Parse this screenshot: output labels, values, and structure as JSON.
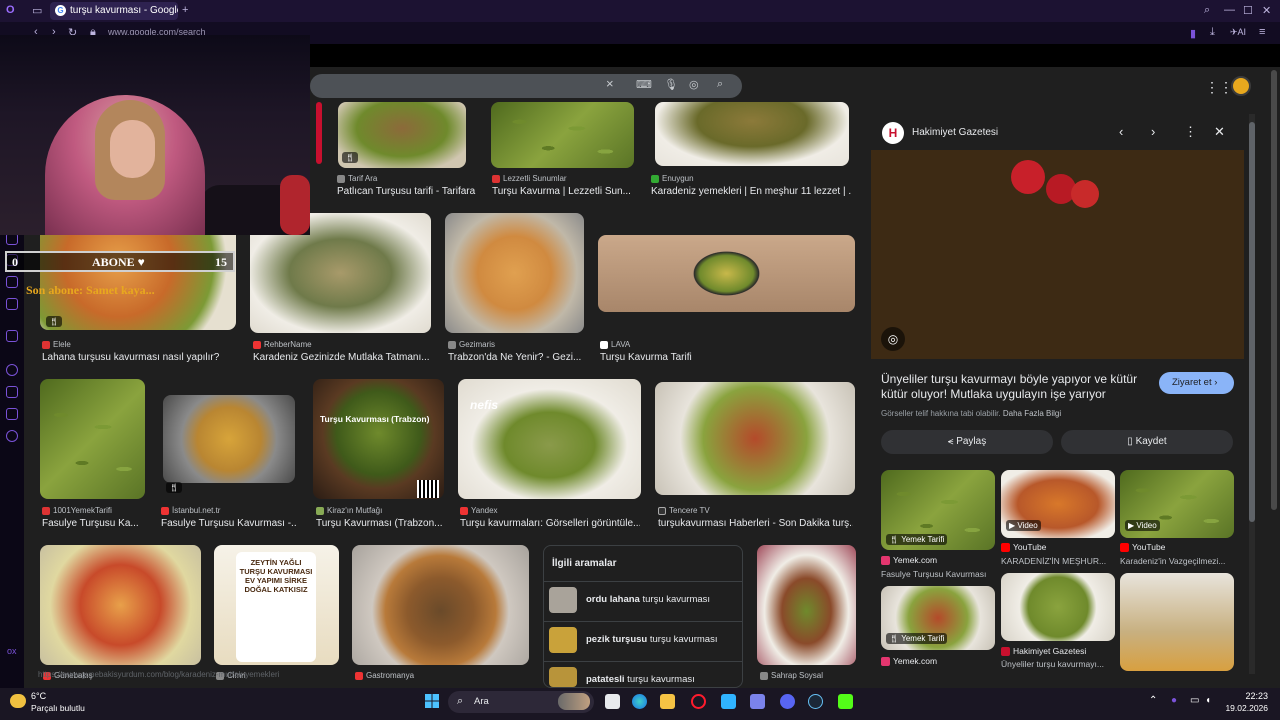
{
  "browser": {
    "tab_title": "turşu kavurması - Google'd",
    "url": "www.google.com/search",
    "ai_label": "AI"
  },
  "stream_overlay": {
    "sub_left": "0",
    "sub_label": "ABONE ♥",
    "sub_right": "15",
    "last_sub": "Son abone: Samet kaya..."
  },
  "search": {
    "clear_icon": "×"
  },
  "grid": {
    "row1": [
      {
        "source": "Tarif Ara",
        "caption": "Patlıcan Turşusu tarifi - Tarifara"
      },
      {
        "source": "Lezzetli Sunumlar",
        "caption": "Turşu Kavurma | Lezzetli Sun..."
      },
      {
        "source": "Enuygun",
        "caption": "Karadeniz yemekleri | En meşhur 11 lezzet | ..."
      }
    ],
    "row2": [
      {
        "source": "Elele",
        "caption": "Lahana turşusu kavurması nasıl yapılır?"
      },
      {
        "source": "RehberName",
        "caption": "Karadeniz Gezinizde Mutlaka Tatmanı..."
      },
      {
        "source": "Gezimaris",
        "caption": "Trabzon'da Ne Yenir? - Gezi..."
      },
      {
        "source": "LAVA",
        "caption": "Turşu Kavurma Tarifi"
      }
    ],
    "row3": [
      {
        "source": "1001YemekTarifi",
        "caption": "Fasulye Turşusu Ka..."
      },
      {
        "source": "İstanbul.net.tr",
        "caption": "Fasulye Turşusu Kavurması -..."
      },
      {
        "source": "Kiraz'ın Mutfağı",
        "caption": "Turşu Kavurması (Trabzon..."
      },
      {
        "source": "Yandex",
        "caption": "Turşu kavurmaları: Görselleri görüntüle..."
      },
      {
        "source": "Tencere TV",
        "caption": "turşukavurması Haberleri - Son Dakika turş..."
      }
    ],
    "row4": [
      {
        "source": "Günebakış"
      },
      {
        "source": "Cimri"
      },
      {
        "source": "Gastromanya"
      },
      {
        "source": "Sahrap Soysal"
      }
    ],
    "jar_text": "ZEYTİN YAĞLI TURŞU KAVURMASI EV YAPIMI SİRKE DOĞAL KATKISIZ",
    "trabzon_overlay": "Turşu Kavurması (Trabzon)",
    "nefis_logo": "nefis"
  },
  "related": {
    "title": "İlgili aramalar",
    "items": [
      {
        "bold": "ordu lahana",
        "rest": " turşu kavurması"
      },
      {
        "bold": "pezik turşusu",
        "rest": " turşu kavurması"
      },
      {
        "bold": "patatesli",
        "rest": " turşu kavurması"
      }
    ]
  },
  "panel": {
    "source": "Hakimiyet Gazetesi",
    "logo_letter": "H",
    "title": "Ünyeliler turşu kavurmayı böyle yapıyor ve kütür kütür oluyor! Mutlaka uygulayın işe yarıyor",
    "visit": "Ziyaret et",
    "copyright": "Görseller telif hakkına tabi olabilir.",
    "learn_more": "Daha Fazla Bilgi",
    "share": "Paylaş",
    "save": "Kaydet",
    "related": [
      {
        "badge": "Yemek Tarifi",
        "source": "Yemek.com",
        "caption": "Fasulye Turşusu Kavurması"
      },
      {
        "badge": "Video",
        "source": "YouTube",
        "caption": "KARADENİZ'İN MEŞHUR..."
      },
      {
        "badge": "Video",
        "source": "YouTube",
        "caption": "Karadeniz'in Vazgeçilmezi..."
      },
      {
        "badge": "Yemek Tarifi",
        "source": "Yemek.com",
        "caption": ""
      },
      {
        "badge": "",
        "source": "Hakimiyet Gazetesi",
        "caption": "Ünyeliler turşu kavurmayı..."
      },
      {
        "badge": "",
        "source": "",
        "caption": ""
      }
    ]
  },
  "status_url": "https://www.gunebakisyurdum.com/blog/karadeniz-mutfak-yemekleri",
  "taskbar": {
    "temp": "6°C",
    "weather": "Parçalı bulutlu",
    "search": "Ara",
    "time": "22:23",
    "date": "19.02.2026"
  },
  "colors": {
    "accent": "#8ab4f8",
    "opera_purple": "#7a52d8",
    "page_bg": "#1f1f1f"
  }
}
